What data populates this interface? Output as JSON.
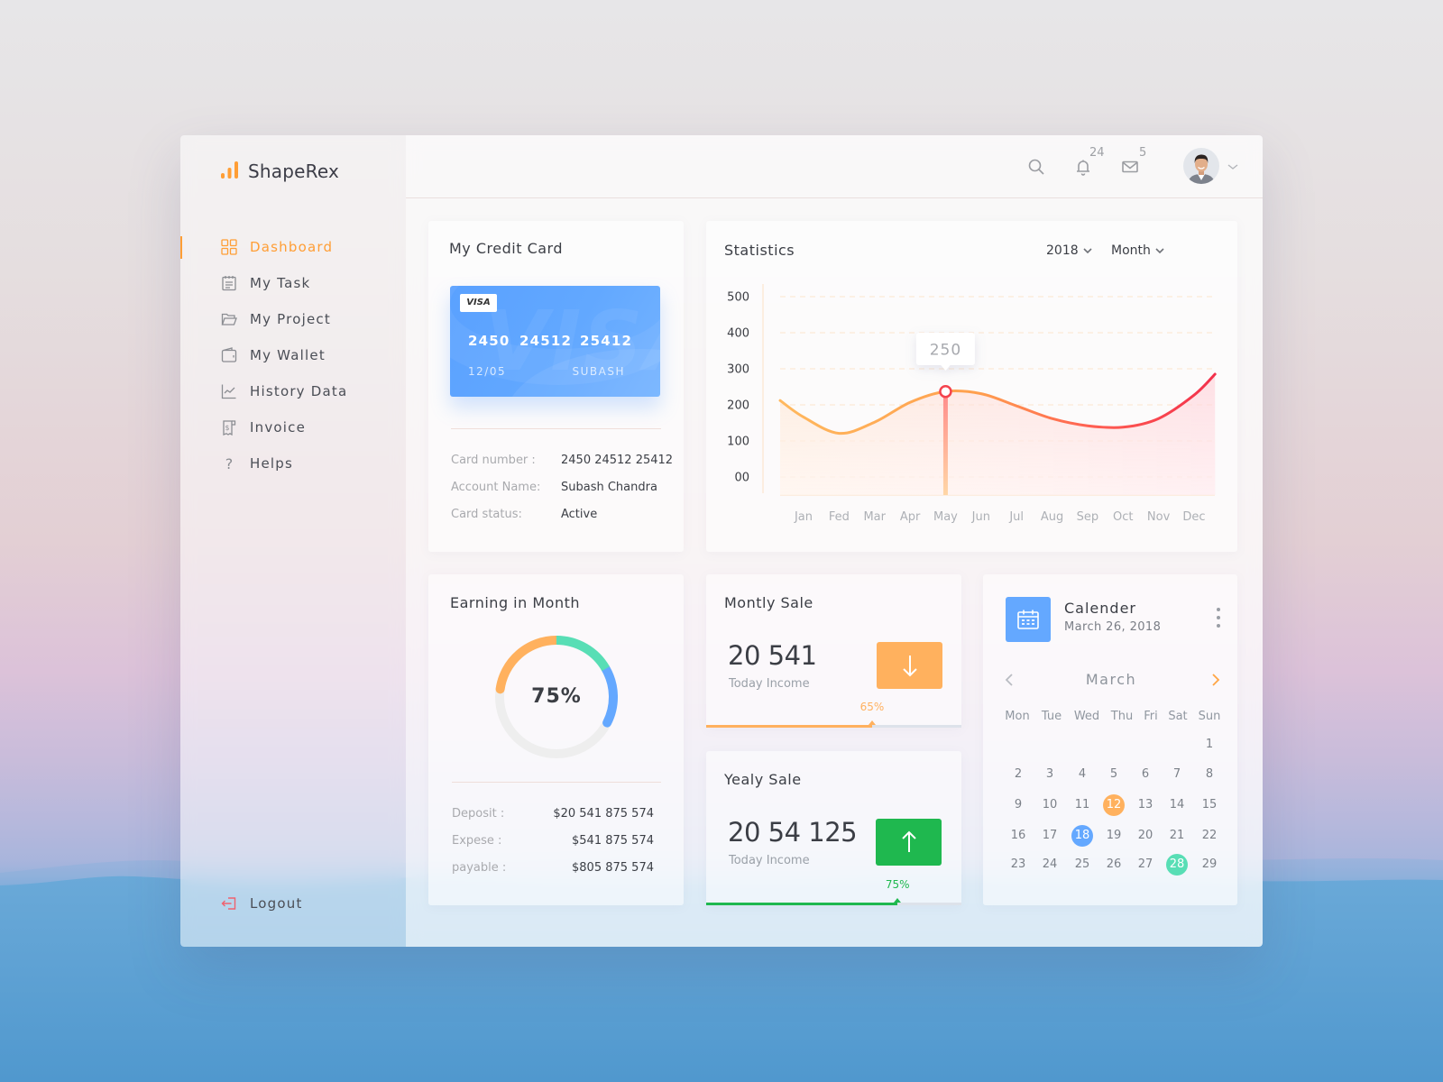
{
  "app": {
    "name": "ShapeRex"
  },
  "colors": {
    "accent": "#FF9E35",
    "blue": "#64A8FF",
    "green": "#1FB84F",
    "teal": "#58DEB5",
    "orange": "#FFB15E",
    "red": "#F4334C",
    "logout": "#F0616E"
  },
  "sidebar": {
    "items": [
      {
        "label": "Dashboard",
        "icon": "grid-icon",
        "active": true
      },
      {
        "label": "My Task",
        "icon": "clipboard-icon",
        "active": false
      },
      {
        "label": "My Project",
        "icon": "folder-icon",
        "active": false
      },
      {
        "label": "My Wallet",
        "icon": "wallet-icon",
        "active": false
      },
      {
        "label": "History Data",
        "icon": "line-chart-icon",
        "active": false
      },
      {
        "label": "Invoice",
        "icon": "invoice-icon",
        "active": false
      },
      {
        "label": "Helps",
        "icon": "question-icon",
        "active": false
      }
    ],
    "logout": {
      "label": "Logout",
      "icon": "logout-icon"
    }
  },
  "header": {
    "icons": [
      "search-icon",
      "bell-icon",
      "mail-icon",
      "avatar",
      "chevron-down-icon"
    ],
    "notification_count": "24",
    "message_count": "5"
  },
  "credit_card": {
    "title": "My Credit Card",
    "brand": "VISA",
    "number_groups": [
      "2450",
      "24512",
      "25412"
    ],
    "expiry": "12/05",
    "holder": "SUBASH",
    "details": [
      {
        "label": "Card number :",
        "value": "2450 24512 25412"
      },
      {
        "label": "Account Name:",
        "value": "Subash Chandra"
      },
      {
        "label": "Card status:",
        "value": "Active"
      }
    ]
  },
  "statistics": {
    "title": "Statistics",
    "year": "2018",
    "period": "Month"
  },
  "chart_data": {
    "type": "line",
    "title": "Statistics",
    "xlabel": "",
    "ylabel": "",
    "categories": [
      "Jan",
      "Fed",
      "Mar",
      "Apr",
      "May",
      "Jun",
      "Jul",
      "Aug",
      "Sep",
      "Oct",
      "Nov",
      "Dec"
    ],
    "series": [
      {
        "name": "Statistics",
        "values": [
          166,
          121,
          152,
          207,
          237,
          231,
          197,
          162,
          142,
          138,
          162,
          227
        ]
      }
    ],
    "curve_start": {
      "x": 0.34,
      "y": 212
    },
    "curve_end": {
      "x": 12.59,
      "y": 285
    },
    "y_ticks": [
      500,
      400,
      300,
      200,
      100,
      0
    ],
    "y_tick_labels": [
      "500",
      "400",
      "300",
      "200",
      "100",
      "00"
    ],
    "ylim": [
      -50,
      500
    ],
    "grid": true,
    "highlight": {
      "index": 4,
      "category": "May",
      "label": "250"
    }
  },
  "earning": {
    "title": "Earning in Month",
    "percent_label": "75%",
    "ring": {
      "track_color": "#EEEEEE",
      "segments": [
        {
          "color": "#FFB15E",
          "from": 0.772,
          "to": 1.0
        },
        {
          "color": "#58DEB5",
          "from": 0.0,
          "to": 0.167
        },
        {
          "color": "#64A8FF",
          "from": 0.167,
          "to": 0.325
        }
      ]
    },
    "rows": [
      {
        "label": "Deposit :",
        "value": "$20 541 875 574"
      },
      {
        "label": "Expese :",
        "value": "$541 875 574"
      },
      {
        "label": "payable :",
        "value": "$805 875 574"
      }
    ]
  },
  "monthly_sale": {
    "title": "Montly Sale",
    "amount": "20 541",
    "caption": "Today Income",
    "trend": "down",
    "color": "#FFB15E",
    "progress_percent": 65,
    "progress_label": "65%"
  },
  "yearly_sale": {
    "title": "Yealy Sale",
    "amount": "20 54 125",
    "caption": "Today Income",
    "trend": "up",
    "color": "#1FB84F",
    "progress_percent": 75,
    "progress_label": "75%"
  },
  "calendar": {
    "title": "Calender",
    "date": "March 26, 2018",
    "month": "March",
    "weekdays": [
      "Mon",
      "Tue",
      "Wed",
      "Thu",
      "Fri",
      "Sat",
      "Sun"
    ],
    "weeks": [
      [
        null,
        null,
        null,
        null,
        null,
        null,
        1
      ],
      [
        2,
        3,
        4,
        5,
        6,
        7,
        8
      ],
      [
        9,
        10,
        11,
        12,
        13,
        14,
        15
      ],
      [
        16,
        17,
        18,
        19,
        20,
        21,
        22
      ],
      [
        23,
        24,
        25,
        26,
        27,
        28,
        29
      ]
    ],
    "highlights": [
      {
        "day": 12,
        "color": "#FFB15E"
      },
      {
        "day": 18,
        "color": "#64A8FF"
      },
      {
        "day": 28,
        "color": "#58DEB5"
      }
    ]
  }
}
